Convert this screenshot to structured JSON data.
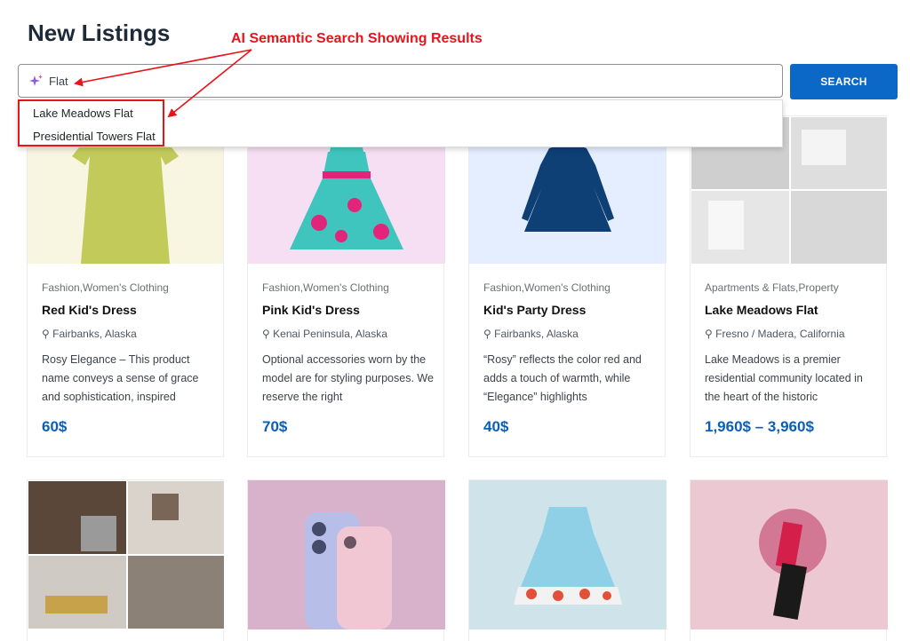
{
  "page": {
    "title": "New Listings"
  },
  "annotation": {
    "text": "AI Semantic Search Showing Results"
  },
  "search": {
    "value": "Flat",
    "button_label": "SEARCH",
    "icon": "sparkle-icon"
  },
  "suggestions": [
    "Lake Meadows Flat",
    "Presidential Towers Flat"
  ],
  "listings": [
    {
      "category": "Fashion,Women's Clothing",
      "name": "Red Kid's Dress",
      "location": "Fairbanks, Alaska",
      "description": "Rosy Elegance – This product name conveys a sense of grace and sophistication, inspired",
      "price": "60$"
    },
    {
      "category": "Fashion,Women's Clothing",
      "name": "Pink Kid's Dress",
      "location": "Kenai Peninsula, Alaska",
      "description": "Optional accessories worn by the model are for styling purposes. We reserve the right",
      "price": "70$"
    },
    {
      "category": "Fashion,Women's Clothing",
      "name": "Kid's Party Dress",
      "location": "Fairbanks, Alaska",
      "description": "“Rosy” reflects the color red and adds a touch of warmth, while “Elegance” highlights",
      "price": "40$"
    },
    {
      "category": "Apartments & Flats,Property",
      "name": "Lake Meadows Flat",
      "location": "Fresno / Madera, California",
      "description": "Lake Meadows is a premier residential community located in the heart of the historic",
      "price": "1,960$ – 3,960$"
    }
  ],
  "colors": {
    "accent": "#0b68c7",
    "price": "#0b5fb7",
    "annotation": "#e8141b"
  }
}
